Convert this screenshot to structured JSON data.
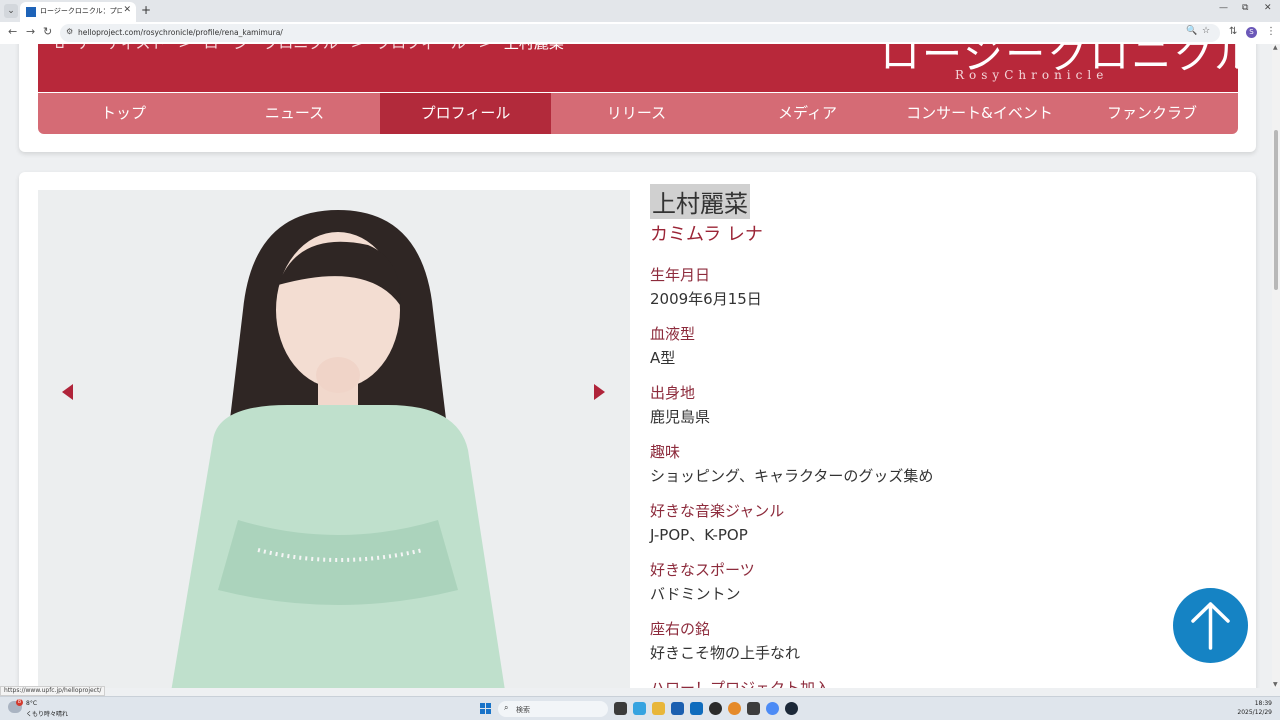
{
  "browser": {
    "tab_title": "ロージークロニクル：プロフィール：ハロー！",
    "tab_menu_icon": "chevron-down-icon",
    "new_tab_icon": "plus-icon",
    "url": "helloproject.com/rosychronicle/profile/rena_kamimura/",
    "status_url": "https://www.upfc.jp/helloproject/"
  },
  "header": {
    "breadcrumb": [
      "アーティスト",
      "ロージークロニクル",
      "プロフィール"
    ],
    "breadcrumb_current": "上村麗菜",
    "separator": ">",
    "logo_jp": "ロージークロニクル",
    "logo_en": "RosyChronicle"
  },
  "nav": {
    "items": [
      {
        "label": "トップ"
      },
      {
        "label": "ニュース"
      },
      {
        "label": "プロフィール"
      },
      {
        "label": "リリース"
      },
      {
        "label": "メディア"
      },
      {
        "label": "コンサート&イベント"
      },
      {
        "label": "ファンクラブ"
      }
    ],
    "active_index": 2
  },
  "profile": {
    "name": "上村麗菜",
    "kana": "カミムラ レナ",
    "fields": [
      {
        "label": "生年月日",
        "value": "2009年6月15日"
      },
      {
        "label": "血液型",
        "value": "A型"
      },
      {
        "label": "出身地",
        "value": "鹿児島県"
      },
      {
        "label": "趣味",
        "value": "ショッピング、キャラクターのグッズ集め"
      },
      {
        "label": "好きな音楽ジャンル",
        "value": "J-POP、K-POP"
      },
      {
        "label": "好きなスポーツ",
        "value": "バドミントン"
      },
      {
        "label": "座右の銘",
        "value": "好きこそ物の上手なれ"
      },
      {
        "label": "ハロー！プロジェクト加入",
        "value": ""
      }
    ]
  },
  "colors": {
    "brand": "#b8283a",
    "menu": "#d56b75",
    "label": "#8d2b3c",
    "to_top": "#1583c4"
  },
  "taskbar": {
    "weather_badge": "8",
    "weather_temp": "8°C",
    "weather_desc": "くもり時々晴れ",
    "search_placeholder": "検索",
    "time": "18:39",
    "date": "2025/12/29"
  }
}
